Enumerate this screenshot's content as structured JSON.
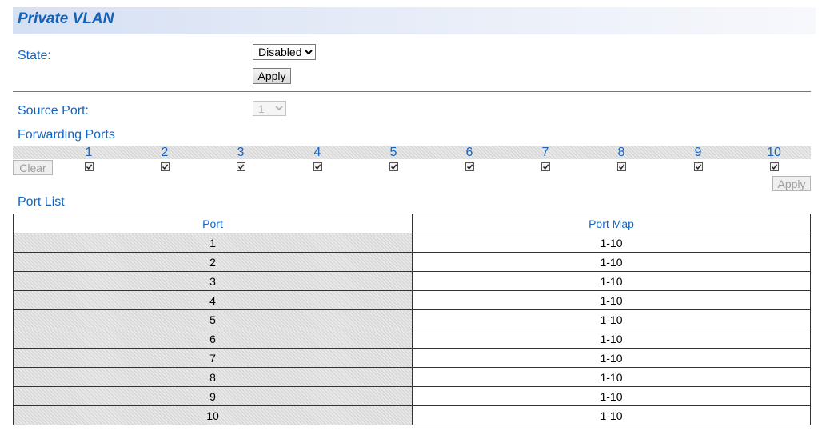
{
  "page": {
    "title": "Private VLAN"
  },
  "state": {
    "label": "State:",
    "value": "Disabled",
    "options": [
      "Disabled"
    ],
    "apply_label": "Apply"
  },
  "source_port": {
    "label": "Source Port:",
    "value": "1"
  },
  "forwarding": {
    "label": "Forwarding Ports",
    "clear_label": "Clear",
    "apply_label": "Apply",
    "ports": [
      {
        "num": "1",
        "checked": true
      },
      {
        "num": "2",
        "checked": true
      },
      {
        "num": "3",
        "checked": true
      },
      {
        "num": "4",
        "checked": true
      },
      {
        "num": "5",
        "checked": true
      },
      {
        "num": "6",
        "checked": true
      },
      {
        "num": "7",
        "checked": true
      },
      {
        "num": "8",
        "checked": true
      },
      {
        "num": "9",
        "checked": true
      },
      {
        "num": "10",
        "checked": true
      }
    ]
  },
  "port_list": {
    "label": "Port List",
    "columns": [
      "Port",
      "Port Map"
    ],
    "rows": [
      {
        "port": "1",
        "map": "1-10"
      },
      {
        "port": "2",
        "map": "1-10"
      },
      {
        "port": "3",
        "map": "1-10"
      },
      {
        "port": "4",
        "map": "1-10"
      },
      {
        "port": "5",
        "map": "1-10"
      },
      {
        "port": "6",
        "map": "1-10"
      },
      {
        "port": "7",
        "map": "1-10"
      },
      {
        "port": "8",
        "map": "1-10"
      },
      {
        "port": "9",
        "map": "1-10"
      },
      {
        "port": "10",
        "map": "1-10"
      }
    ]
  },
  "colors": {
    "accent": "#1565c0",
    "title": "#1461b8"
  }
}
